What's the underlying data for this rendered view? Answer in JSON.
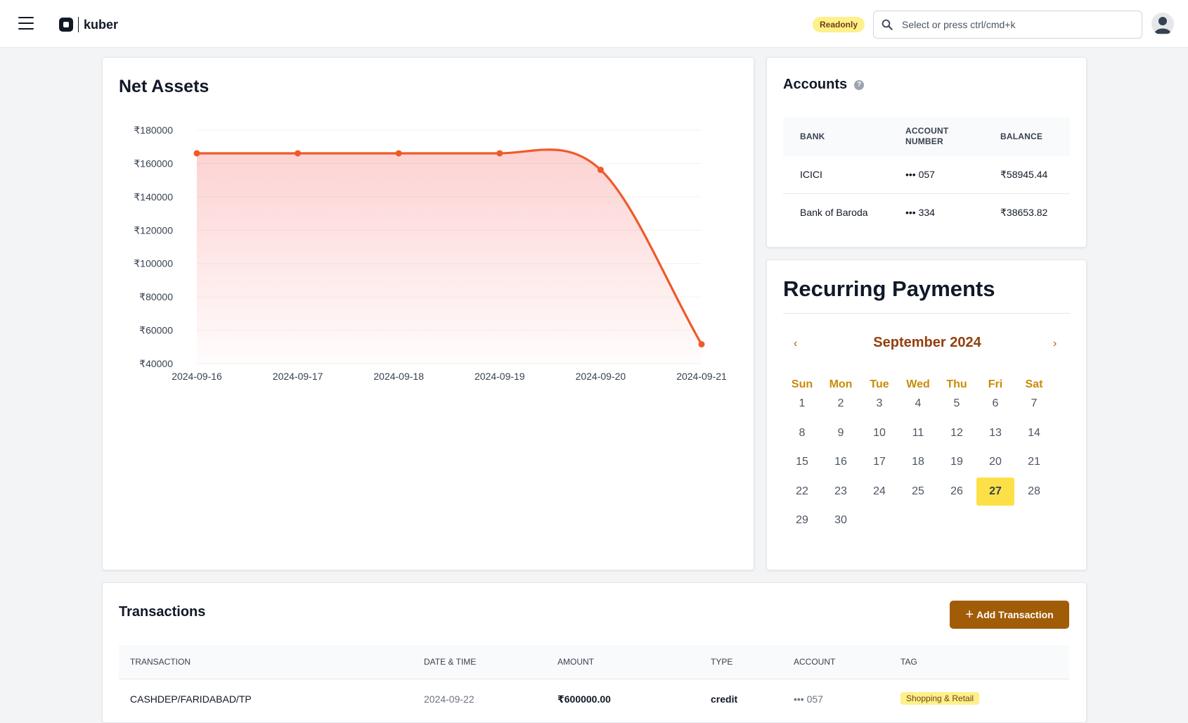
{
  "header": {
    "brand": "kuber",
    "badge": "Readonly",
    "search_placeholder": "Select or press ctrl/cmd+k"
  },
  "net_assets": {
    "title": "Net Assets"
  },
  "chart_data": {
    "type": "area",
    "title": "Net Assets",
    "x": [
      "2024-09-16",
      "2024-09-17",
      "2024-09-18",
      "2024-09-19",
      "2024-09-20",
      "2024-09-21"
    ],
    "values": [
      166100,
      166100,
      166100,
      166100,
      156200,
      51600
    ],
    "yticks": [
      "₹180000",
      "₹160000",
      "₹140000",
      "₹120000",
      "₹100000",
      "₹80000",
      "₹60000",
      "₹40000"
    ],
    "ylim": [
      40000,
      180000
    ],
    "grid": true,
    "colors": {
      "line": "#ef5a2a",
      "fill": "#fca5a5"
    }
  },
  "accounts": {
    "title": "Accounts",
    "columns": [
      "BANK",
      "ACCOUNT NUMBER",
      "BALANCE"
    ],
    "rows": [
      {
        "bank": "ICICI",
        "number": "••• 057",
        "balance": "₹58945.44"
      },
      {
        "bank": "Bank of Baroda",
        "number": "••• 334",
        "balance": "₹38653.82"
      }
    ]
  },
  "recurring": {
    "title": "Recurring Payments",
    "month": "September 2024",
    "weekdays": [
      "Sun",
      "Mon",
      "Tue",
      "Wed",
      "Thu",
      "Fri",
      "Sat"
    ],
    "days": [
      1,
      2,
      3,
      4,
      5,
      6,
      7,
      8,
      9,
      10,
      11,
      12,
      13,
      14,
      15,
      16,
      17,
      18,
      19,
      20,
      21,
      22,
      23,
      24,
      25,
      26,
      27,
      28,
      29,
      30
    ],
    "first_weekday": 0,
    "today": 27
  },
  "transactions": {
    "title": "Transactions",
    "add_label": "Add Transaction",
    "columns": [
      "TRANSACTION",
      "DATE & TIME",
      "AMOUNT",
      "TYPE",
      "ACCOUNT",
      "TAG"
    ],
    "rows": [
      {
        "name": "CASHDEP/FARIDABAD/TP",
        "date": "2024-09-22",
        "amount": "₹600000.00",
        "type": "credit",
        "account": "••• 057",
        "tag": "Shopping & Retail"
      }
    ]
  }
}
